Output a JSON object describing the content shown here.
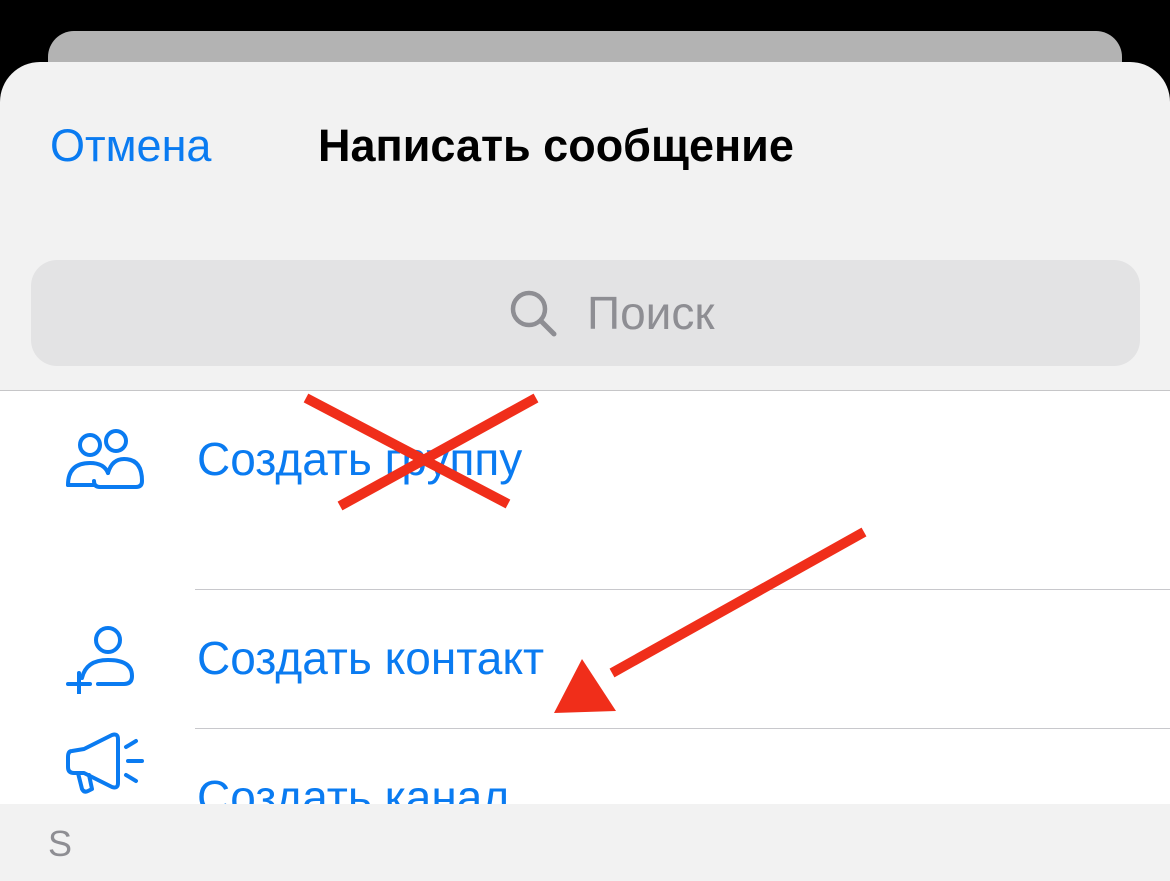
{
  "header": {
    "cancel_label": "Отмена",
    "title": "Написать сообщение"
  },
  "search": {
    "placeholder": "Поиск",
    "icon": "search-icon"
  },
  "menu": {
    "items": [
      {
        "label": "Создать группу",
        "icon": "group-icon",
        "crossed_out": true
      },
      {
        "label": "Создать контакт",
        "icon": "add-contact-icon"
      },
      {
        "label": "Создать канал",
        "icon": "megaphone-icon",
        "highlighted_by_arrow": true
      }
    ]
  },
  "contacts_section": {
    "letter": "S"
  },
  "colors": {
    "accent": "#0a7bf1",
    "annotation": "#f02e1a",
    "sheet_background": "#f2f2f2",
    "search_field": "#e3e3e4",
    "secondary_text": "#8e8e93"
  }
}
